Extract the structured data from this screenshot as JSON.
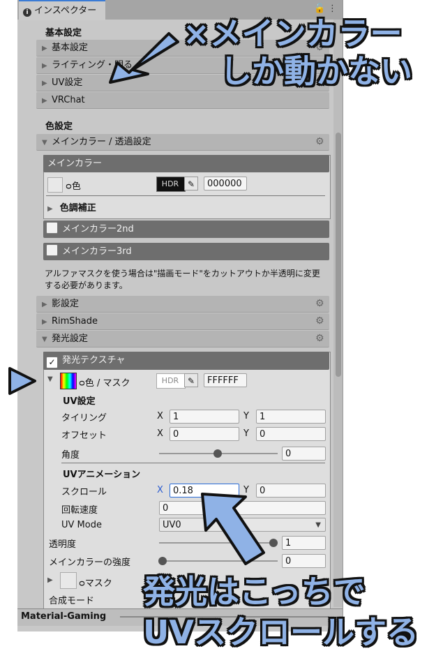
{
  "window": {
    "tab_title": "インスペクター",
    "lock_glyph": "🔓",
    "menu_glyph": "⋮"
  },
  "basic": {
    "heading": "基本設定",
    "folds": [
      "基本設定",
      "ライティング・明る",
      "UV設定",
      "VRChat"
    ]
  },
  "color": {
    "heading": "色設定",
    "main_fold": "メインカラー / 透過設定",
    "main_panel_title": "メインカラー",
    "color_label": "色",
    "hdr": "HDR",
    "main_hex": "000000",
    "tone_label": "色調補正",
    "second": "メインカラー2nd",
    "third": "メインカラー3rd",
    "note": "アルファマスクを使う場合は\"描画モード\"をカットアウトか半透明に変更する必要があります。"
  },
  "more_folds": [
    "影設定",
    "RimShade",
    "発光設定"
  ],
  "emission": {
    "title": "発光テクスチャ",
    "color_mask_label": "色 / マスク",
    "hdr": "HDR",
    "hex": "FFFFFF",
    "uv_heading": "UV設定",
    "tiling_label": "タイリング",
    "offset_label": "オフセット",
    "angle_label": "角度",
    "x": "X",
    "y": "Y",
    "tiling_x": "1",
    "tiling_y": "1",
    "offset_x": "0",
    "offset_y": "0",
    "angle": "0",
    "anim_heading": "UVアニメーション",
    "scroll_label": "スクロール",
    "scroll_x": "0.18",
    "scroll_y": "0",
    "rotate_label": "回転速度",
    "rotate": "0",
    "uvmode_label": "UV Mode",
    "uvmode": "UV0",
    "alpha_label": "透明度",
    "alpha": "1",
    "maincolor_strength_label": "メインカラーの強度",
    "maincolor_strength": "0",
    "mask_label": "マスク",
    "blend_label": "合成モード"
  },
  "footer": {
    "material": "Material-Gaming"
  },
  "annotations": {
    "top_line1": "×メインカラー",
    "top_line2": "しか動かない",
    "bottom_line1": "発光はこっちで",
    "bottom_line2": "UVスクロールする"
  },
  "colors": {
    "annotation_fill": "#8fb2e6",
    "annotation_outline": "#111111",
    "tab_accent": "#3a7bd5"
  }
}
